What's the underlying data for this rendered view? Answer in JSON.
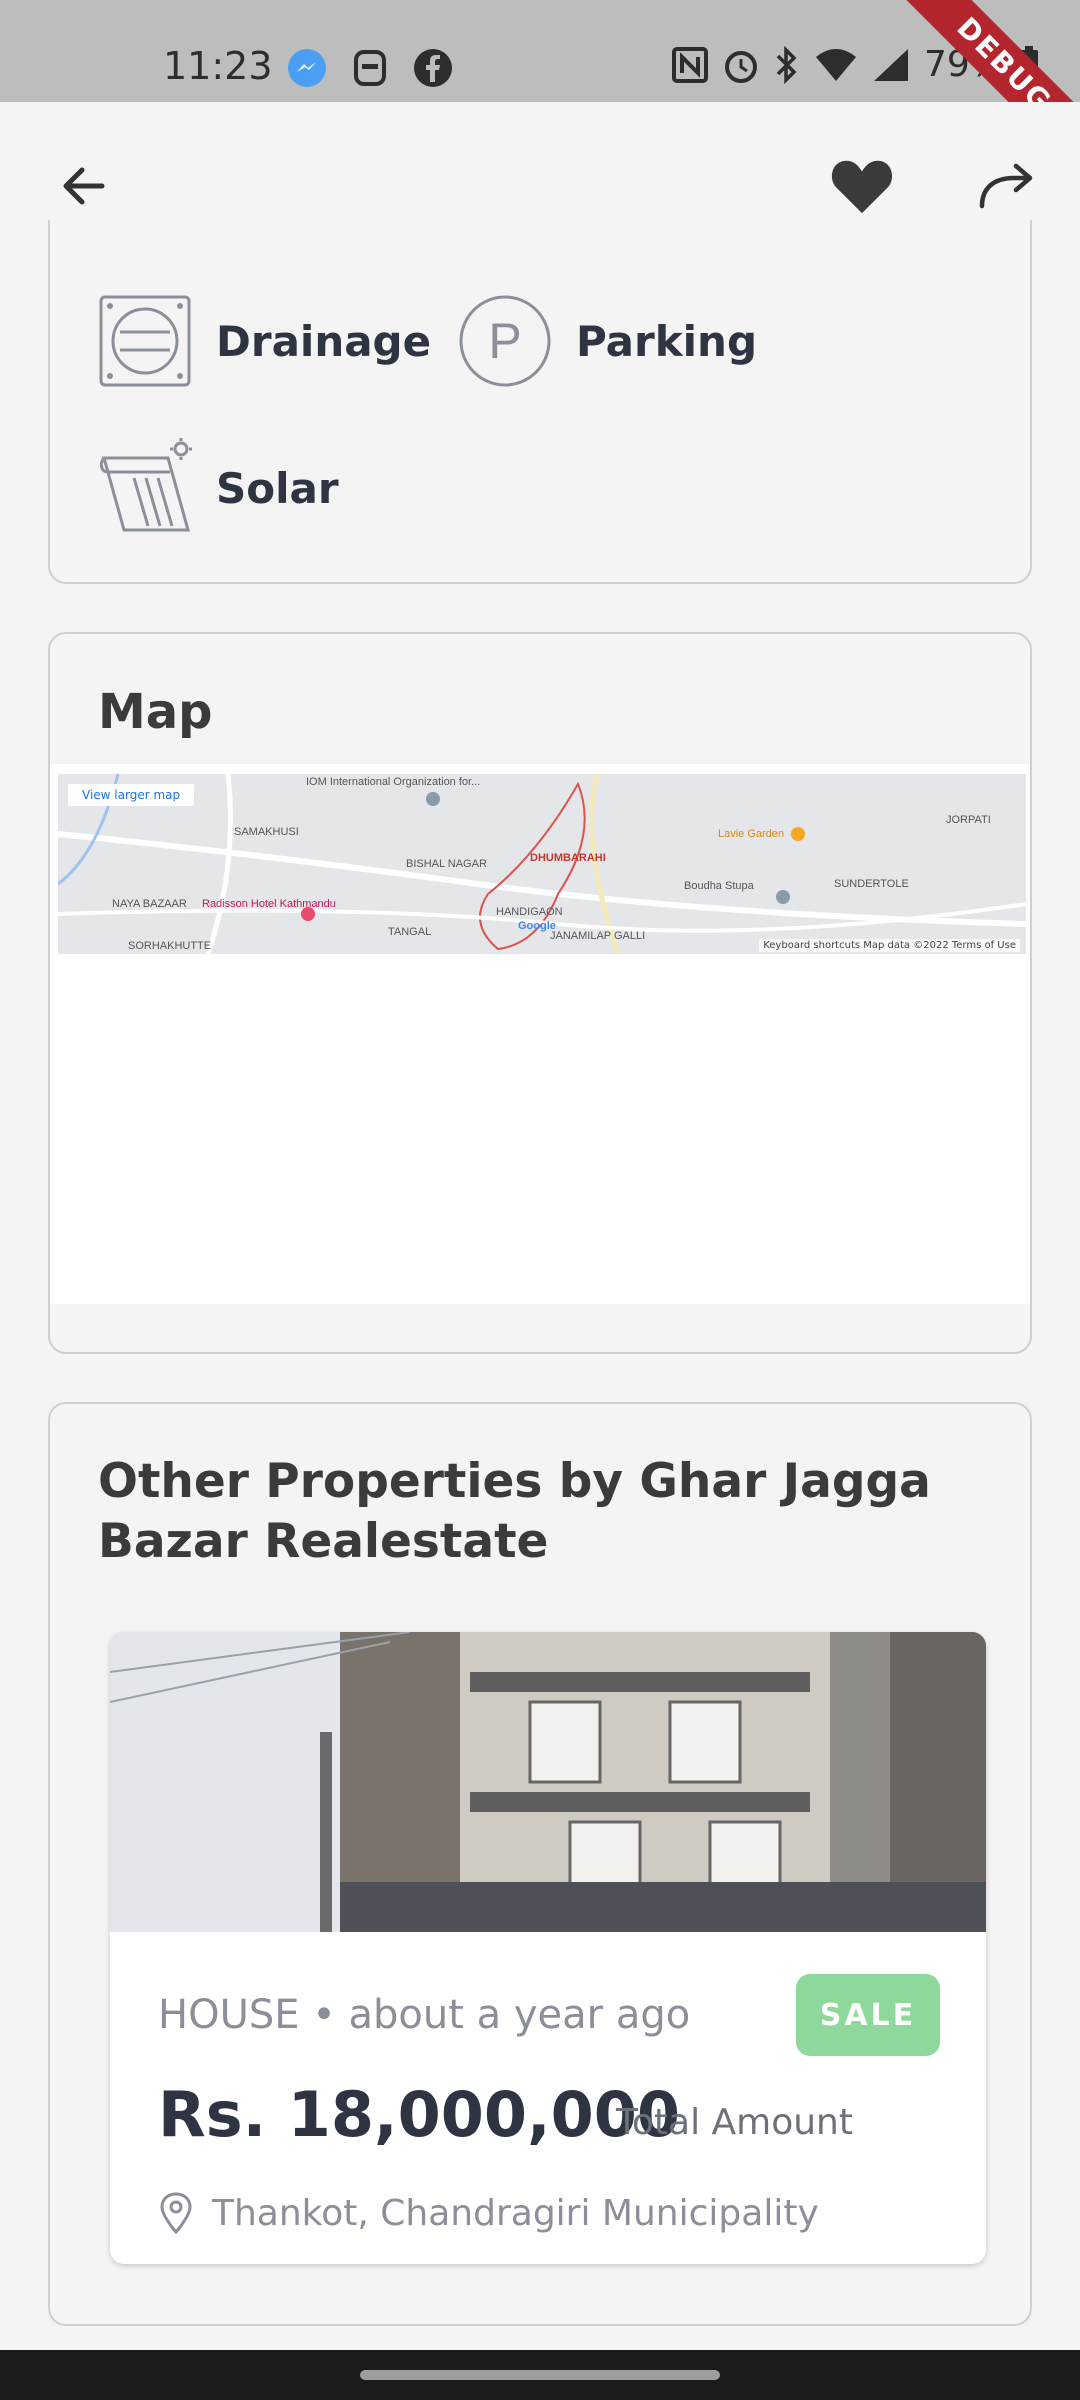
{
  "status_bar": {
    "time": "11:23",
    "battery": "79%",
    "debug_label": "DEBUG",
    "icons": [
      "messenger-icon",
      "sim-icon",
      "facebook-icon",
      "nfc-icon",
      "alarm-icon",
      "bluetooth-icon",
      "wifi-icon",
      "signal-icon",
      "battery-icon"
    ]
  },
  "app_bar": {
    "back_icon": "arrow-left-icon",
    "favorite_icon": "heart-icon",
    "share_icon": "share-icon"
  },
  "amenities": [
    {
      "label": "Drainage",
      "icon": "drainage-icon"
    },
    {
      "label": "Parking",
      "icon": "parking-icon",
      "glyph": "P"
    },
    {
      "label": "Solar",
      "icon": "solar-icon"
    }
  ],
  "map": {
    "title": "Map",
    "view_larger": "View larger map",
    "labels": [
      "IOM International Organization for...",
      "SAMAKHUSI",
      "BISHAL NAGAR",
      "DHUMBARAHI",
      "Lavie Garden",
      "JORPATI",
      "NAYA BAZAAR",
      "Radisson Hotel Kathmandu",
      "HANDIGAON",
      "Boudha Stupa",
      "SUNDERTOLE",
      "SORHAKHUTTE",
      "TANGAL",
      "JANAMILAP GALLI"
    ],
    "footer": "Keyboard shortcuts   Map data ©2022   Terms of Use",
    "google": "Google"
  },
  "other_properties": {
    "title": "Other Properties by Ghar Jagga Bazar Realestate",
    "items": [
      {
        "type": "HOUSE • about a year ago",
        "badge": "SALE",
        "price": "Rs. 18,000,000",
        "price_label": "Total Amount",
        "location": "Thankot, Chandragiri  Municipality"
      }
    ]
  },
  "colors": {
    "accent_sale": "#8fd89b",
    "debug": "#b3262d",
    "text_dark": "#2e3442"
  }
}
